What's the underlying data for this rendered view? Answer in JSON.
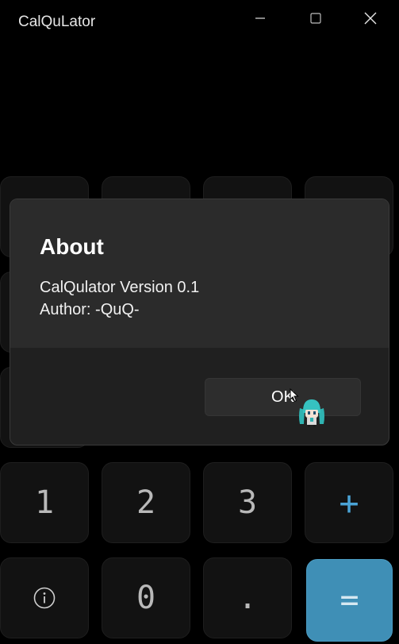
{
  "window": {
    "title": "CalQuLator",
    "controls": [
      "minimize-icon",
      "maximize-icon",
      "close-icon"
    ]
  },
  "keypad": {
    "rows": [
      [
        {
          "label": "1",
          "kind": "digit"
        },
        {
          "label": "2",
          "kind": "digit"
        },
        {
          "label": "3",
          "kind": "digit"
        },
        {
          "label": "+",
          "kind": "operator"
        }
      ],
      [
        {
          "label": "",
          "kind": "info",
          "icon": "info-icon"
        },
        {
          "label": "0",
          "kind": "digit"
        },
        {
          "label": ".",
          "kind": "digit"
        },
        {
          "label": "=",
          "kind": "equals"
        }
      ]
    ]
  },
  "dialog": {
    "title": "About",
    "lines": [
      "CalQulator Version 0.1",
      "Author: -QuQ-"
    ],
    "ok_label": "OK"
  },
  "colors": {
    "background": "#000000",
    "key": "#121212",
    "key_text": "#b9b9b9",
    "accent": "#4aa3d6",
    "equals_bg": "#3f8fb6",
    "dialog_top": "#2b2b2b",
    "dialog_bottom": "#202020"
  }
}
